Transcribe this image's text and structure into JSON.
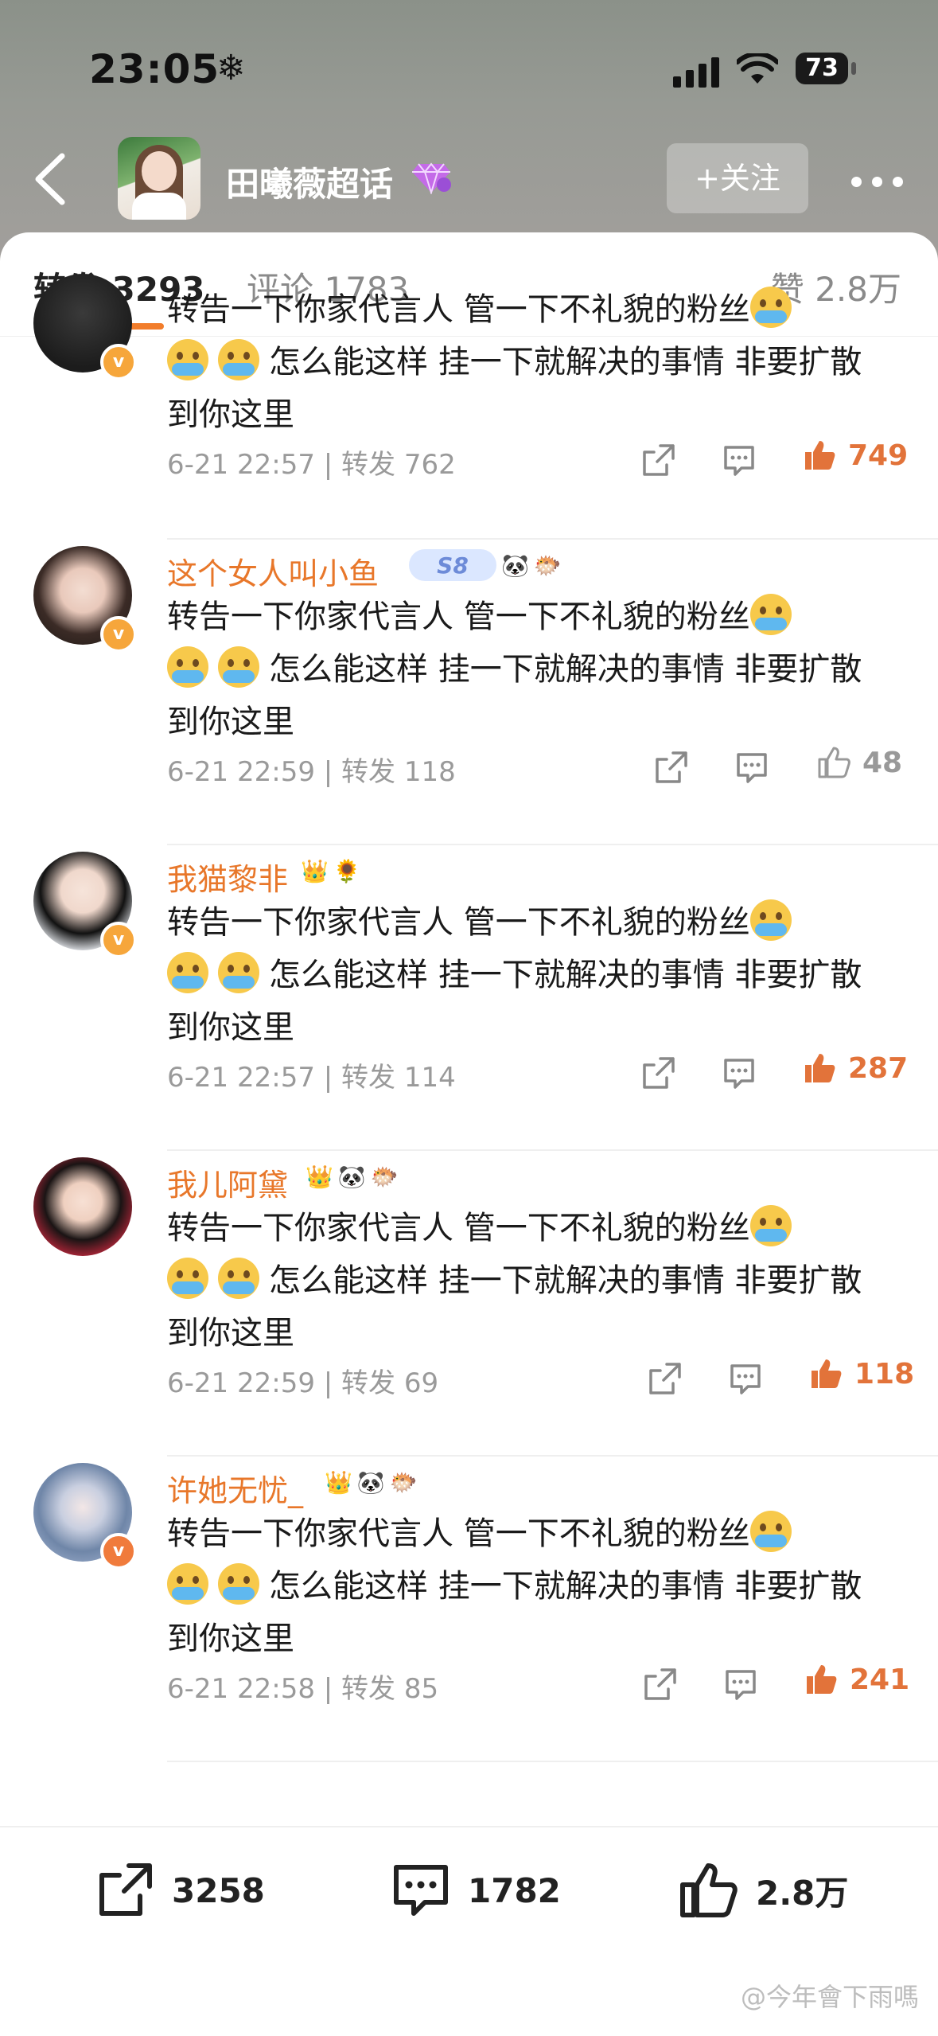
{
  "status_bar": {
    "time": "23:05",
    "battery": "73"
  },
  "nav": {
    "title": "田曦薇超话",
    "follow_label": "+关注"
  },
  "tabs": {
    "repost": "转发 3293",
    "comment": "评论 1783",
    "like": "赞 2.8万"
  },
  "colors": {
    "accent": "#f27d2b",
    "username": "#e8772a",
    "liked": "#e2733a",
    "muted": "#9a9a9a"
  },
  "posts": [
    {
      "username": "",
      "text": "转告一下你家代言人  管一下不礼貌的粉丝",
      "text2": "怎么能这样  挂一下就解决的事情  非要扩散到你这里",
      "meta": "6-21 22:57 | 转发 762",
      "likes": "749",
      "liked": true
    },
    {
      "username": "这个女人叫小鱼",
      "badges": [
        "S8",
        "panda",
        "fish"
      ],
      "text": "转告一下你家代言人  管一下不礼貌的粉丝",
      "text2": "怎么能这样  挂一下就解决的事情  非要扩散到你这里",
      "meta": "6-21 22:59 | 转发 118",
      "likes": "48",
      "liked": false
    },
    {
      "username": "我猫黎非",
      "badges": [
        "crown",
        "sunflower"
      ],
      "text": "转告一下你家代言人  管一下不礼貌的粉丝",
      "text2": "怎么能这样  挂一下就解决的事情  非要扩散到你这里",
      "meta": "6-21 22:57 | 转发 114",
      "likes": "287",
      "liked": true
    },
    {
      "username": "我儿阿黛",
      "badges": [
        "crown",
        "panda",
        "fish"
      ],
      "text": "转告一下你家代言人  管一下不礼貌的粉丝",
      "text2": "怎么能这样  挂一下就解决的事情  非要扩散到你这里",
      "meta": "6-21 22:59 | 转发 69",
      "likes": "118",
      "liked": true
    },
    {
      "username": "许她无忧_",
      "badges": [
        "crown",
        "panda",
        "fish"
      ],
      "text": "转告一下你家代言人  管一下不礼貌的粉丝",
      "text2": "怎么能这样  挂一下就解决的事情  非要扩散到你这里",
      "meta": "6-21 22:58 | 转发 85",
      "likes": "241",
      "liked": true
    }
  ],
  "bottom_bar": {
    "repost_count": "3258",
    "comment_count": "1782",
    "like_count": "2.8万"
  },
  "watermark": "@今年會下雨嗎"
}
